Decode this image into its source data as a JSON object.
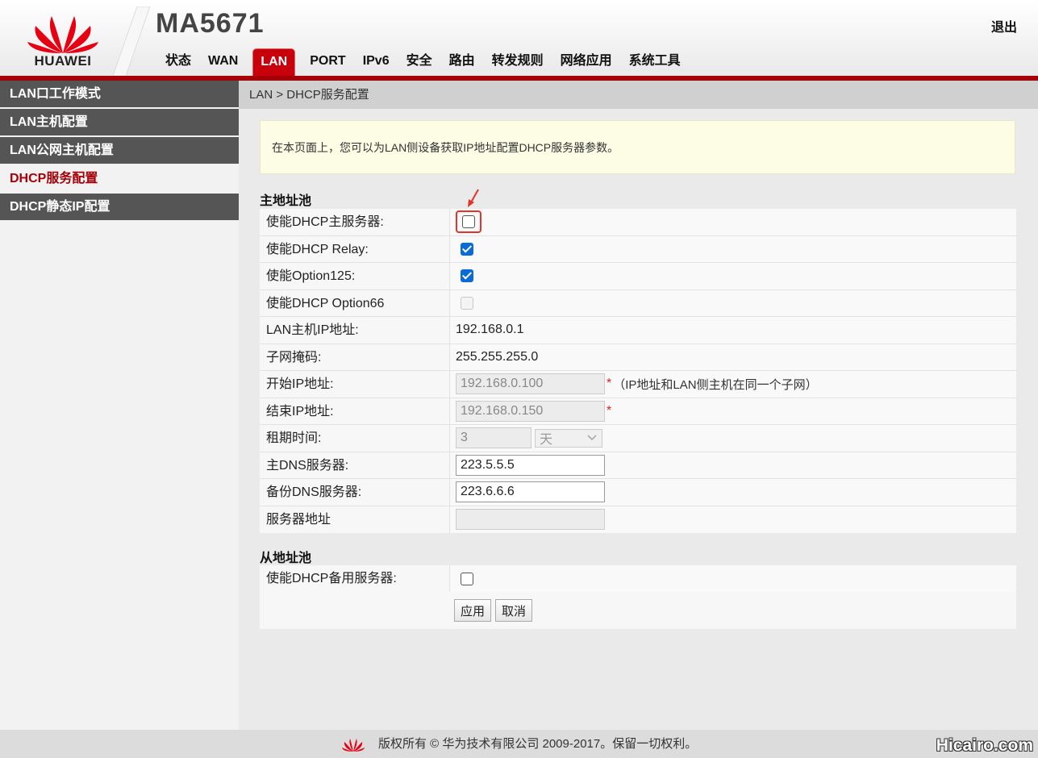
{
  "header": {
    "brand": "HUAWEI",
    "device_name": "MA5671",
    "logout": "退出",
    "nav": [
      "状态",
      "WAN",
      "LAN",
      "PORT",
      "IPv6",
      "安全",
      "路由",
      "转发规则",
      "网络应用",
      "系统工具"
    ],
    "active_nav": "LAN"
  },
  "sidebar": {
    "items": [
      {
        "label": "LAN口工作模式"
      },
      {
        "label": "LAN主机配置"
      },
      {
        "label": "LAN公网主机配置"
      },
      {
        "label": "DHCP服务配置"
      },
      {
        "label": "DHCP静态IP配置"
      }
    ],
    "active": "DHCP服务配置"
  },
  "breadcrumb": "LAN > DHCP服务配置",
  "notice": "在本页面上，您可以为LAN侧设备获取IP地址配置DHCP服务器参数。",
  "primary_pool": {
    "title": "主地址池",
    "rows": {
      "enable_dhcp_server": {
        "label": "使能DHCP主服务器:",
        "checked": false
      },
      "enable_dhcp_relay": {
        "label": "使能DHCP Relay:",
        "checked": true
      },
      "enable_option125": {
        "label": "使能Option125:",
        "checked": true
      },
      "enable_option66": {
        "label": "使能DHCP Option66",
        "checked": false,
        "disabled": true
      },
      "lan_host_ip": {
        "label": "LAN主机IP地址:",
        "value": "192.168.0.1"
      },
      "subnet_mask": {
        "label": "子网掩码:",
        "value": "255.255.255.0"
      },
      "start_ip": {
        "label": "开始IP地址:",
        "value": "192.168.0.100",
        "required": "*",
        "hint": "（IP地址和LAN侧主机在同一个子网）"
      },
      "end_ip": {
        "label": "结束IP地址:",
        "value": "192.168.0.150",
        "required": "*"
      },
      "lease_time": {
        "label": "租期时间:",
        "value": "3",
        "unit": "天"
      },
      "primary_dns": {
        "label": "主DNS服务器:",
        "value": "223.5.5.5"
      },
      "backup_dns": {
        "label": "备份DNS服务器:",
        "value": "223.6.6.6"
      },
      "server_address": {
        "label": "服务器地址",
        "value": ""
      }
    }
  },
  "secondary_pool": {
    "title": "从地址池",
    "enable_backup_server": {
      "label": "使能DHCP备用服务器:",
      "checked": false
    }
  },
  "buttons": {
    "apply": "应用",
    "cancel": "取消"
  },
  "footer": {
    "copyright": "版权所有 © 华为技术有限公司 2009-2017。保留一切权利。",
    "watermark": "Hicairo.com"
  },
  "colors": {
    "brand_red": "#c7000b",
    "sidebar_bg": "#555555",
    "notice_bg": "#fdfde6",
    "checkbox_blue": "#0a6bd6"
  }
}
